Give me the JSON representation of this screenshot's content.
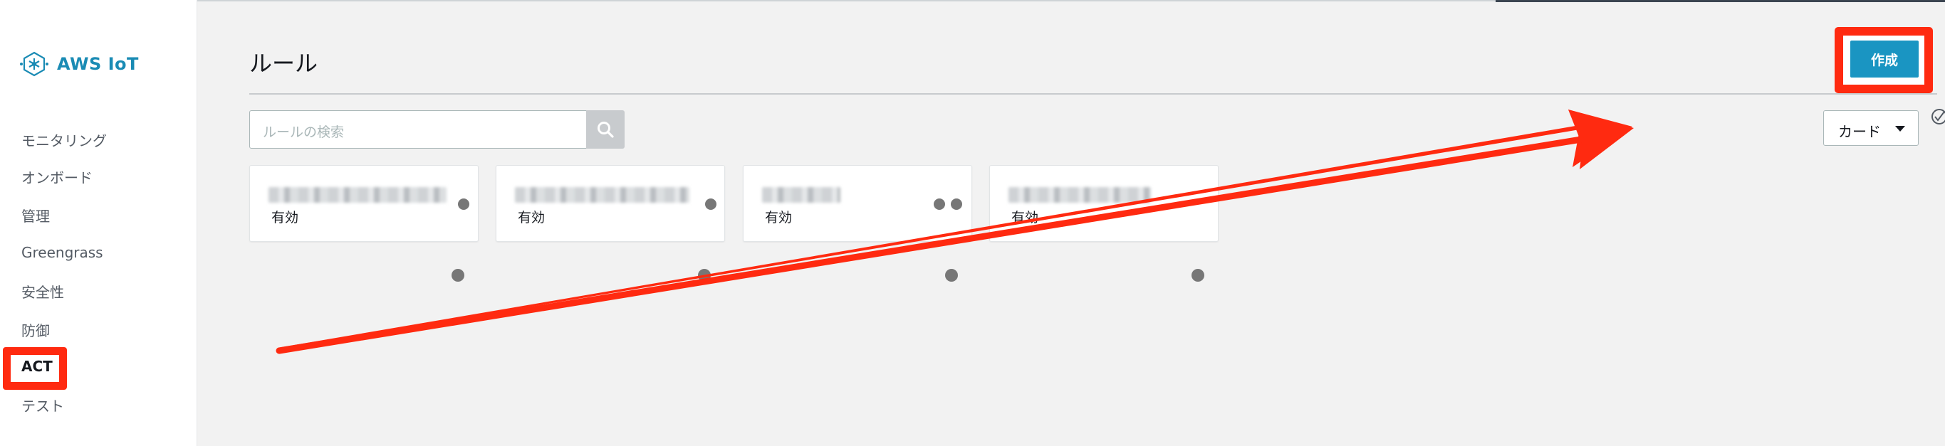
{
  "app": {
    "title": "AWS IoT"
  },
  "sidebar": {
    "items": [
      {
        "label": "モニタリング"
      },
      {
        "label": "オンボード"
      },
      {
        "label": "管理"
      },
      {
        "label": "Greengrass"
      },
      {
        "label": "安全性"
      },
      {
        "label": "防御"
      },
      {
        "label": "ACT",
        "selected": true
      },
      {
        "label": "テスト"
      }
    ]
  },
  "main": {
    "title": "ルール",
    "create_label": "作成",
    "search": {
      "placeholder": "ルールの検索"
    },
    "view_select": {
      "value": "カード"
    },
    "cards": [
      {
        "name": "",
        "status": "有効"
      },
      {
        "name": "",
        "status": "有効"
      },
      {
        "name": "",
        "status": "有効"
      },
      {
        "name": "",
        "status": "有効"
      }
    ]
  },
  "icons": {
    "logo": "aws-iot-logo-icon",
    "search": "search-icon",
    "caret": "caret-down-icon",
    "help": "help-icon",
    "check": "check-circle-icon"
  },
  "colors": {
    "accent": "#1a95c2",
    "annotation": "#ff2a10",
    "background": "#f2f2f2"
  }
}
